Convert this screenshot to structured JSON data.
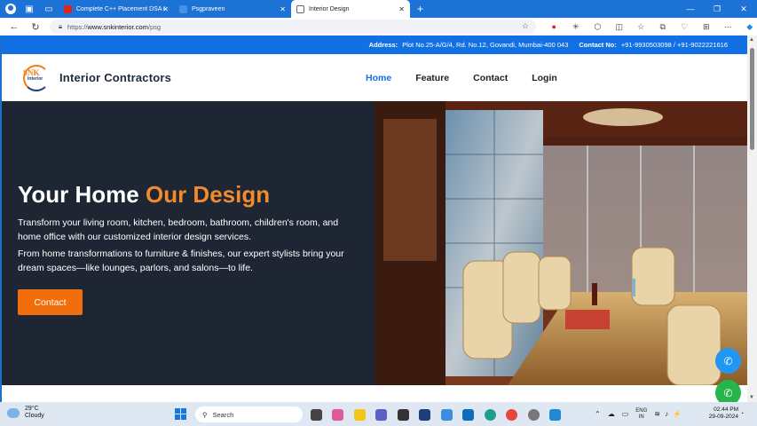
{
  "browser": {
    "tabs": [
      {
        "label": "Complete C++ Placement DSA C",
        "favicon_color": "#e62117"
      },
      {
        "label": "Psgpraveen",
        "favicon_color": "#4a90e2"
      },
      {
        "label": "Interior Design",
        "favicon_color": "#666666"
      }
    ],
    "active_tab": 2,
    "url_prefix": "https://",
    "url_host": "www.snkinterior.com",
    "url_path": "/psg"
  },
  "site": {
    "topbar": {
      "address_label": "Address:",
      "address_value": "Plot No.25-A/G/4, Rd. No.12, Govandi, Mumbai-400 043",
      "contact_label": "Contact No:",
      "contact_value": "+91-9930503098 / +91-9022221616"
    },
    "logo": {
      "text": "SNK",
      "sub": "Interior"
    },
    "brand": "Interior Contractors",
    "menu": [
      "Home",
      "Feature",
      "Contact",
      "Login"
    ],
    "hero": {
      "title_main": "Your Home ",
      "title_accent": "Our Design",
      "p1": "Transform your living room, kitchen, bedroom, bathroom, children's room, and home office with our customized interior design services.",
      "p2": "From home transformations to furniture & finishes, our expert stylists bring your dream spaces—like lounges, parlors, and salons—to life.",
      "button": "Contact"
    },
    "colors": {
      "accent": "#f28a2e",
      "primary": "#1170e4",
      "button": "#f26e0c"
    }
  },
  "taskbar": {
    "weather_temp": "29°C",
    "weather_desc": "Cloudy",
    "search_label": "Search",
    "lang_top": "ENG",
    "lang_bottom": "IN",
    "time": "02:44 PM",
    "date": "29-09-2024"
  }
}
